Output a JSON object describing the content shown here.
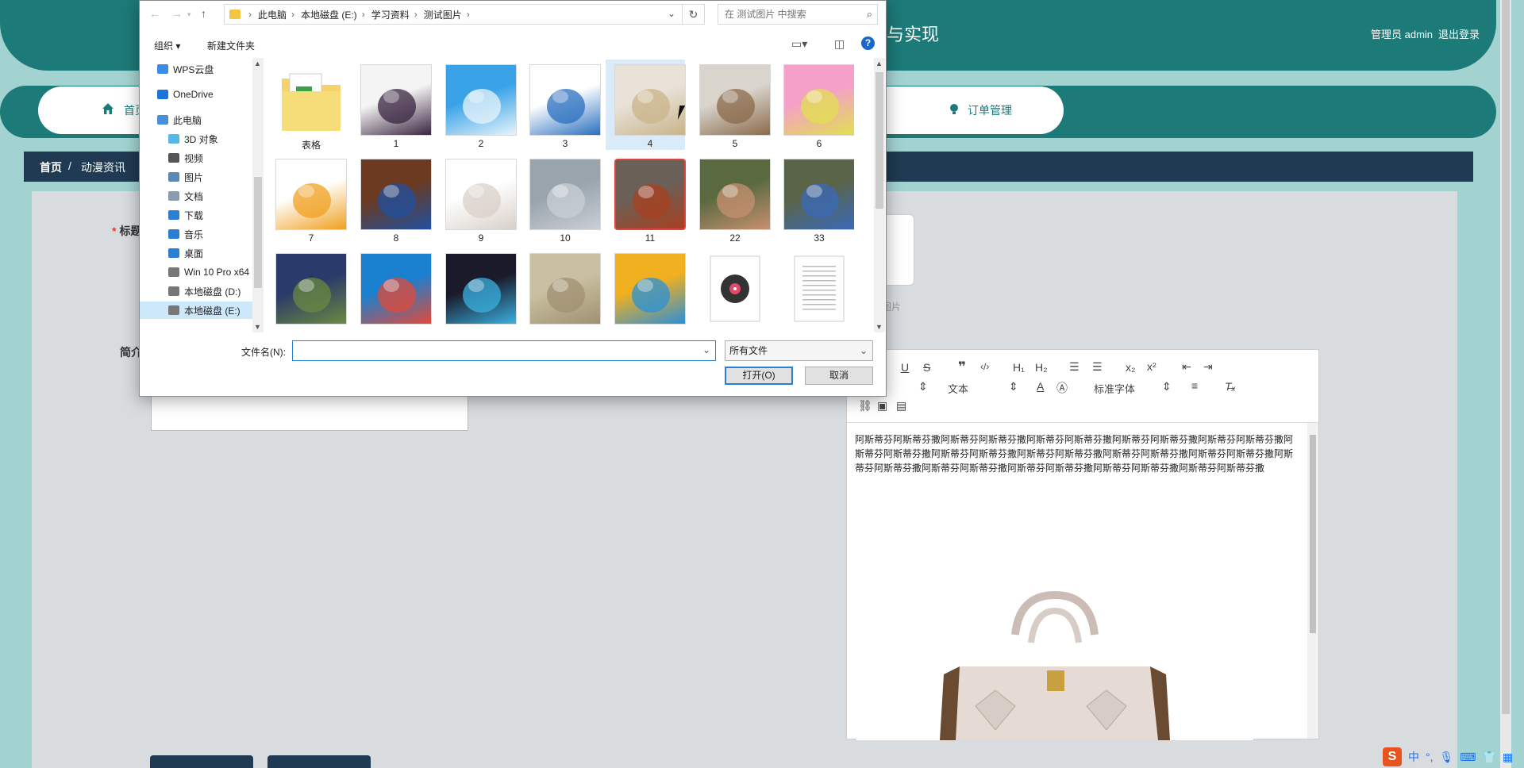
{
  "header": {
    "title_fragment": "与实现",
    "admin_label": "管理员 admin",
    "logout_label": "退出登录"
  },
  "nav": {
    "home_label": "首页",
    "order_label": "订单管理"
  },
  "breadcrumb": {
    "home": "首页",
    "sep": "/",
    "current": "动漫资讯"
  },
  "form": {
    "title_label": "标题",
    "intro_label": "简介",
    "upload_hint": "图片"
  },
  "editor": {
    "text_select": "文本",
    "font_select": "标准字体",
    "body_text": "阿斯蒂芬阿斯蒂芬撒阿斯蒂芬阿斯蒂芬撒阿斯蒂芬阿斯蒂芬撒阿斯蒂芬阿斯蒂芬撒阿斯蒂芬阿斯蒂芬撒阿斯蒂芬阿斯蒂芬撒阿斯蒂芬阿斯蒂芬撒阿斯蒂芬阿斯蒂芬撒阿斯蒂芬阿斯蒂芬撒阿斯蒂芬阿斯蒂芬撒阿斯蒂芬阿斯蒂芬撒阿斯蒂芬阿斯蒂芬撒阿斯蒂芬阿斯蒂芬撒阿斯蒂芬阿斯蒂芬撒阿斯蒂芬阿斯蒂芬撒"
  },
  "ime": {
    "logo": "S",
    "lang": "中"
  },
  "dialog": {
    "path": [
      "此电脑",
      "本地磁盘 (E:)",
      "学习资料",
      "测试图片"
    ],
    "search_placeholder": "在 测试图片 中搜索",
    "organize_label": "组织 ▾",
    "new_folder_label": "新建文件夹",
    "help_label": "?",
    "nav_items": [
      {
        "label": "WPS云盘",
        "color": "#3d8be8"
      },
      {
        "label": "OneDrive",
        "color": "#1e73d8"
      },
      {
        "label": "此电脑",
        "color": "#4a90d9"
      },
      {
        "label": "3D 对象",
        "color": "#58b6e8"
      },
      {
        "label": "视频",
        "color": "#555555"
      },
      {
        "label": "图片",
        "color": "#5a88b8"
      },
      {
        "label": "文档",
        "color": "#8a9bb0"
      },
      {
        "label": "下载",
        "color": "#2a7fd4"
      },
      {
        "label": "音乐",
        "color": "#2a7fd4"
      },
      {
        "label": "桌面",
        "color": "#2a7fd4"
      },
      {
        "label": "Win 10 Pro x64",
        "color": "#777777"
      },
      {
        "label": "本地磁盘 (D:)",
        "color": "#777777"
      },
      {
        "label": "本地磁盘 (E:)",
        "color": "#777777"
      }
    ],
    "files": [
      {
        "name": "表格",
        "kind": "folder"
      },
      {
        "name": "1",
        "kind": "image",
        "c1": "#f4f4f4",
        "c2": "#3a2440"
      },
      {
        "name": "2",
        "kind": "image",
        "c1": "#3aa3e8",
        "c2": "#e8f4fb"
      },
      {
        "name": "3",
        "kind": "image",
        "c1": "#ffffff",
        "c2": "#2a6fbf"
      },
      {
        "name": "4",
        "kind": "image",
        "c1": "#e8e2d8",
        "c2": "#c9b48a"
      },
      {
        "name": "5",
        "kind": "image",
        "c1": "#d9d4cc",
        "c2": "#8a6a4a"
      },
      {
        "name": "6",
        "kind": "image",
        "c1": "#f5a0c8",
        "c2": "#e0e050"
      },
      {
        "name": "7",
        "kind": "image",
        "c1": "#ffffff",
        "c2": "#f0a020"
      },
      {
        "name": "8",
        "kind": "image",
        "c1": "#6b3a20",
        "c2": "#2050a0"
      },
      {
        "name": "9",
        "kind": "image",
        "c1": "#ffffff",
        "c2": "#d8d0c8"
      },
      {
        "name": "10",
        "kind": "image",
        "c1": "#9aa4ac",
        "c2": "#c8d0d6"
      },
      {
        "name": "11",
        "kind": "image",
        "c1": "#6a6058",
        "c2": "#a84020"
      },
      {
        "name": "22",
        "kind": "image",
        "c1": "#5a6a40",
        "c2": "#c89070"
      },
      {
        "name": "33",
        "kind": "image",
        "c1": "#5a6448",
        "c2": "#3a6ab8"
      },
      {
        "name": "",
        "kind": "image",
        "c1": "#2a3a6a",
        "c2": "#6a8a40"
      },
      {
        "name": "",
        "kind": "image",
        "c1": "#1a80d0",
        "c2": "#e04a3a"
      },
      {
        "name": "",
        "kind": "image",
        "c1": "#1a1a2a",
        "c2": "#3ab0e0"
      },
      {
        "name": "",
        "kind": "image",
        "c1": "#c8c0a0",
        "c2": "#a09070"
      },
      {
        "name": "",
        "kind": "image",
        "c1": "#f0b020",
        "c2": "#2a90d8"
      },
      {
        "name": "",
        "kind": "music"
      },
      {
        "name": "",
        "kind": "doc"
      }
    ],
    "filename_label": "文件名(N):",
    "filename_value": "",
    "filetype_value": "所有文件",
    "open_label": "打开(O)",
    "cancel_label": "取消"
  }
}
